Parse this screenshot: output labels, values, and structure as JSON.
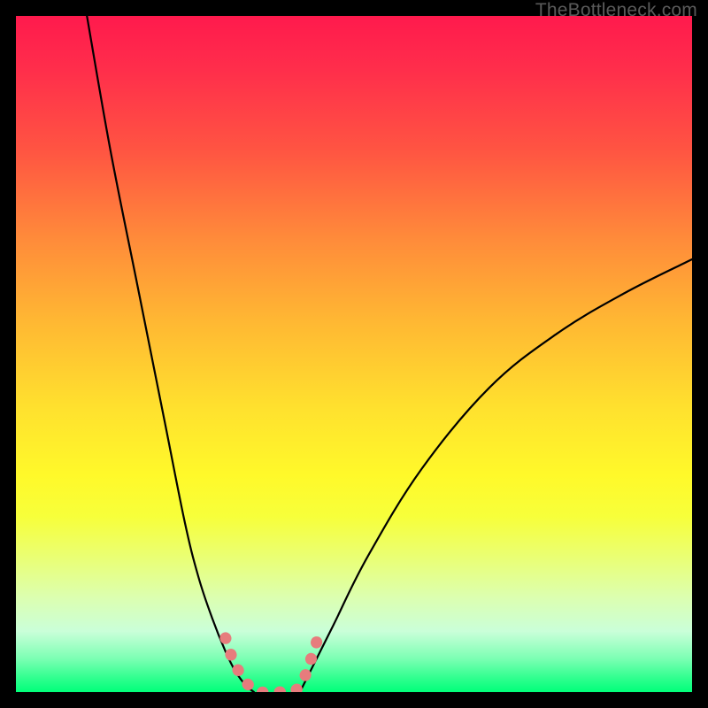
{
  "watermark": "TheBottleneck.com",
  "chart_data": {
    "type": "line",
    "title": "",
    "xlabel": "",
    "ylabel": "",
    "xlim": [
      0,
      100
    ],
    "ylim": [
      0,
      100
    ],
    "grid": false,
    "legend": false,
    "series": [
      {
        "name": "left-curve",
        "x": [
          10.5,
          14,
          18,
          22,
          25,
          27,
          29,
          31,
          32.5,
          34,
          35.2
        ],
        "y": [
          100,
          80,
          60,
          40,
          25,
          17,
          11,
          6,
          3,
          1,
          0
        ]
      },
      {
        "name": "right-curve",
        "x": [
          42,
          44,
          47,
          52,
          60,
          70,
          80,
          90,
          100
        ],
        "y": [
          0,
          4,
          10,
          20,
          33,
          45,
          53,
          59,
          64
        ]
      },
      {
        "name": "valley-marker",
        "x": [
          31,
          32,
          33,
          34,
          35,
          36,
          37.5,
          39,
          40.5,
          42,
          43,
          44,
          45
        ],
        "y": [
          8,
          5,
          3,
          1.5,
          0.5,
          0,
          0,
          0,
          0,
          0.8,
          3,
          6,
          9
        ]
      }
    ],
    "colors": {
      "curve": "#000000",
      "marker": "#e77c7d",
      "gradient_top": "#ff1a4d",
      "gradient_mid": "#ffe12e",
      "gradient_bottom": "#00ff7a"
    }
  }
}
